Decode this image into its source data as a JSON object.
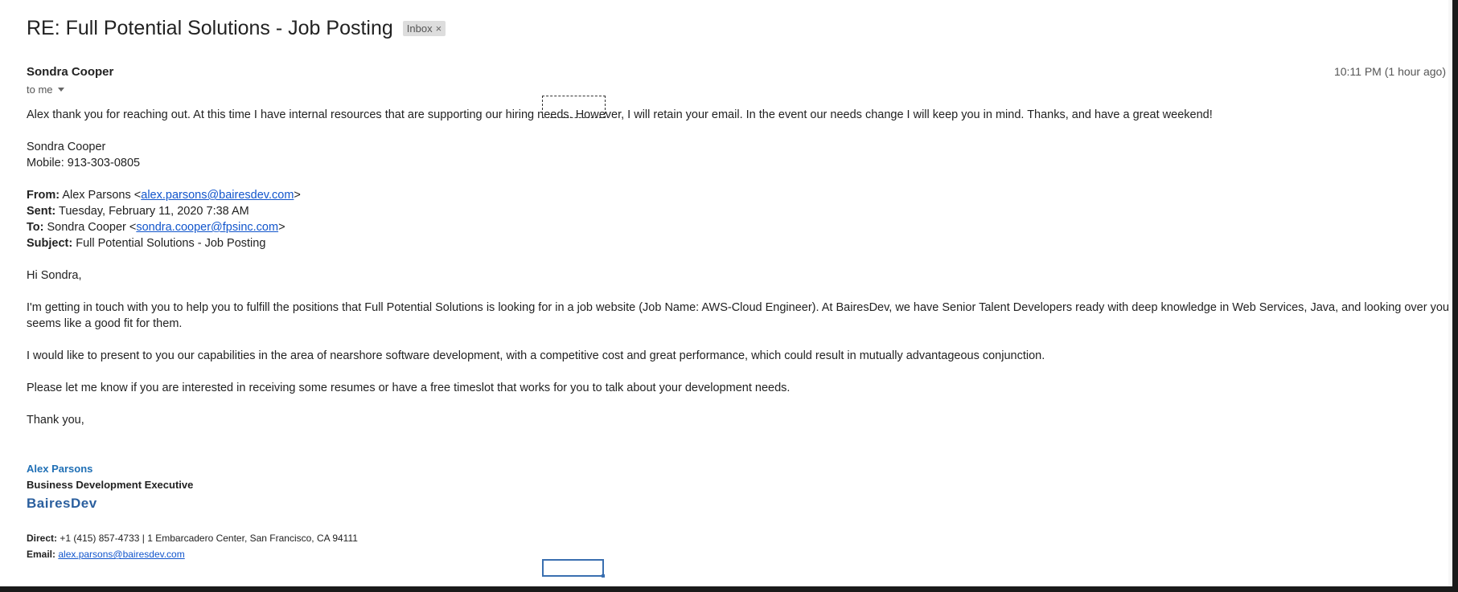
{
  "email": {
    "subject": "RE: Full Potential Solutions - Job Posting",
    "label": "Inbox",
    "label_close": "×",
    "sender": "Sondra Cooper",
    "time": "10:11 PM (1 hour ago)",
    "recipient": "to me",
    "body": {
      "reply_text": "Alex thank you for reaching out. At this time I have internal resources that are supporting our hiring needs. However, I will retain your email. In the event our needs change I will keep you in mind.  Thanks, and have a great weekend!",
      "reply_sig_name": "Sondra Cooper",
      "reply_sig_mobile": "Mobile: 913-303-0805",
      "quoted_header": {
        "from_label": "From:",
        "from_name": " Alex Parsons <",
        "from_email": "alex.parsons@bairesdev.com",
        "from_close": ">",
        "sent_label": "Sent:",
        "sent_value": " Tuesday, February 11, 2020 7:38 AM",
        "to_label": "To:",
        "to_name": " Sondra Cooper <",
        "to_email": "sondra.cooper@fpsinc.com",
        "to_close": ">",
        "subject_label": "Subject:",
        "subject_value": " Full Potential Solutions - Job Posting"
      },
      "greeting": "Hi Sondra,",
      "paragraph_1": "I'm getting in touch with you to help you to fulfill the positions that Full Potential Solutions is looking for in a job website (Job Name: AWS-Cloud Engineer). At BairesDev, we have Senior Talent Developers ready with deep knowledge in Web Services, Java, and looking over your",
      "paragraph_1_cont": "seems like a good fit for them.",
      "paragraph_2": "I would like to present to you our capabilities in the area of nearshore software development, with a competitive cost and great performance, which could result in mutually advantageous conjunction.",
      "paragraph_3": "Please let me know if you are interested in receiving some resumes or have a free timeslot that works for you to talk about your development needs.",
      "closing": "Thank you,",
      "signature": {
        "name": "Alex Parsons",
        "title": "Business Development Executive",
        "company": "BairesDev",
        "direct_label": "Direct:",
        "direct_value": " +1 (415) 857-4733 | 1 Embarcadero Center, San Francisco, CA 94111",
        "email_label": "Email:",
        "email_value": "alex.parsons@bairesdev.com"
      }
    }
  },
  "colors": {
    "link": "#1155cc",
    "signature_name": "#1f6fb5",
    "brand": "#2b5f9e",
    "label_chip_bg": "#dddddd"
  }
}
